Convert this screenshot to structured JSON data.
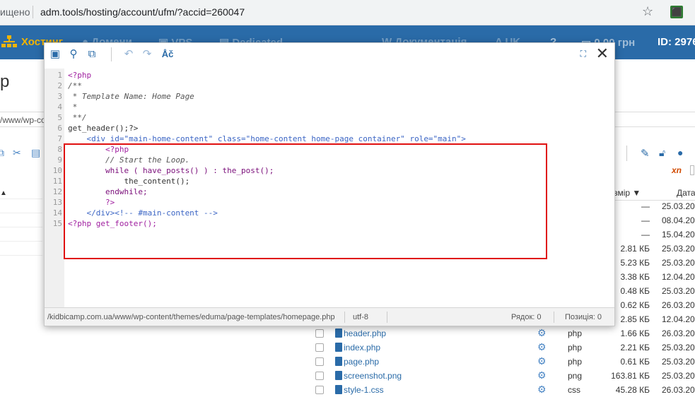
{
  "browser": {
    "security_text": "ищено",
    "url": "adm.tools/hosting/account/ufm/?accid=260047"
  },
  "navbar": {
    "items": [
      "Хостинг",
      "Домени",
      "VPS",
      "Dedicated",
      "Документація",
      "UK"
    ],
    "balance": "0.00 грн",
    "account_id": "ID: 2976"
  },
  "background": {
    "page_title": "р",
    "path_prefix": "/www/wp-co",
    "columns": {
      "size": "змір",
      "date": "Дата"
    },
    "empty_rows": [
      {
        "size": "—",
        "date": "25.03.20"
      },
      {
        "size": "—",
        "date": "08.04.20"
      },
      {
        "size": "—",
        "date": "15.04.20"
      }
    ],
    "size_rows": [
      {
        "size": "2.81 КБ",
        "date": "25.03.20"
      },
      {
        "size": "5.23 КБ",
        "date": "25.03.20"
      },
      {
        "size": "3.38 КБ",
        "date": "12.04.20"
      },
      {
        "size": "0.48 КБ",
        "date": "25.03.20"
      },
      {
        "size": "0.62 КБ",
        "date": "26.03.20"
      },
      {
        "size": "2.85 КБ",
        "date": "12.04.20"
      }
    ],
    "files": [
      {
        "name": "header.php",
        "type": "php",
        "size": "1.66 КБ",
        "date": "26.03.20"
      },
      {
        "name": "index.php",
        "type": "php",
        "size": "2.21 КБ",
        "date": "25.03.20"
      },
      {
        "name": "page.php",
        "type": "php",
        "size": "0.61 КБ",
        "date": "25.03.20"
      },
      {
        "name": "screenshot.png",
        "type": "png",
        "size": "163.81 КБ",
        "date": "25.03.20"
      },
      {
        "name": "style-1.css",
        "type": "css",
        "size": "45.28 КБ",
        "date": "26.03.20"
      }
    ]
  },
  "editor": {
    "toolbar": {
      "save_icon": "save-icon",
      "search_icon": "search-icon",
      "replace_icon": "replace-icon",
      "undo_icon": "undo-icon",
      "redo_icon": "redo-icon",
      "spell_label": "Åč"
    },
    "lines": [
      "<?php",
      "/**",
      " * Template Name: Home Page",
      " *",
      " **/",
      "get_header();?>",
      "    <div id=\"main-home-content\" class=\"home-content home-page container\" role=\"main\">",
      "        <?php",
      "        // Start the Loop.",
      "        while ( have_posts() ) : the_post();",
      "            the_content();",
      "        endwhile;",
      "        ?>",
      "    </div><!-- #main-content -->",
      "<?php get_footer();"
    ],
    "status": {
      "file_path": "/kidbicamp.com.ua/www/wp-content/themes/eduma/page-templates/homepage.php",
      "encoding": "utf-8",
      "row": "Рядок: 0",
      "position": "Позиція: 0"
    }
  },
  "colors": {
    "navbar": "#2a6ba8",
    "highlight": "#e01010",
    "link": "#2a6ba8"
  }
}
